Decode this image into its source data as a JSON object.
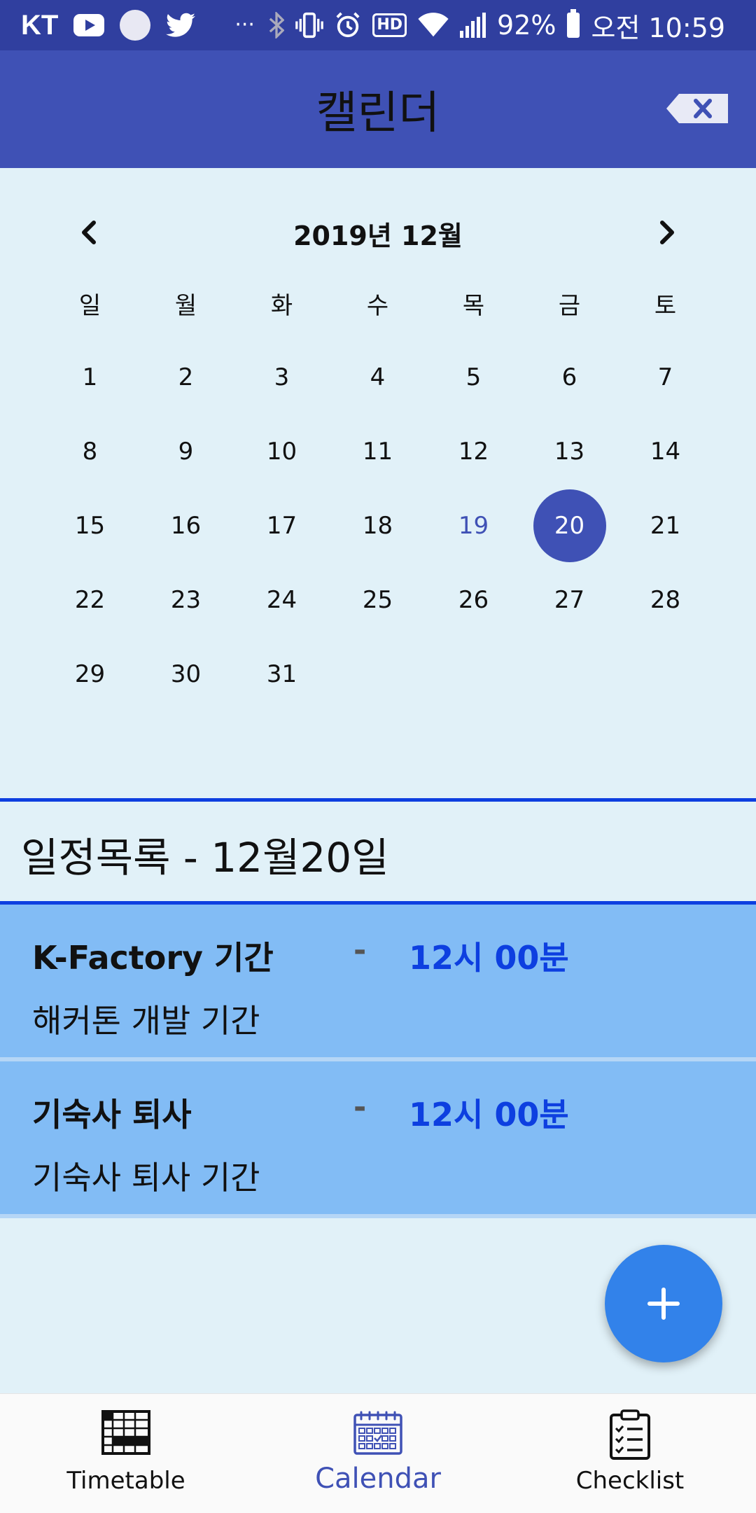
{
  "status_bar": {
    "carrier": "KT",
    "battery": "92%",
    "time": "오전 10:59",
    "more": "···"
  },
  "app_bar": {
    "title": "캘린더"
  },
  "calendar": {
    "month_label": "2019년 12월",
    "weekdays": [
      "일",
      "월",
      "화",
      "수",
      "목",
      "금",
      "토"
    ],
    "weeks": [
      [
        "1",
        "2",
        "3",
        "4",
        "5",
        "6",
        "7"
      ],
      [
        "8",
        "9",
        "10",
        "11",
        "12",
        "13",
        "14"
      ],
      [
        "15",
        "16",
        "17",
        "18",
        "19",
        "20",
        "21"
      ],
      [
        "22",
        "23",
        "24",
        "25",
        "26",
        "27",
        "28"
      ],
      [
        "29",
        "30",
        "31",
        "",
        "",
        "",
        ""
      ]
    ],
    "today": "19",
    "selected": "20"
  },
  "schedule": {
    "title": "일정목록 - 12월20일",
    "events": [
      {
        "name": "K-Factory 기간",
        "dash": "-",
        "time": "12시 00분",
        "desc": "해커톤 개발 기간"
      },
      {
        "name": "기숙사 퇴사",
        "dash": "-",
        "time": "12시 00분",
        "desc": "기숙사 퇴사 기간"
      }
    ]
  },
  "bottom_nav": {
    "items": [
      {
        "label": "Timetable",
        "icon": "timetable-icon"
      },
      {
        "label": "Calendar",
        "icon": "calendar-icon",
        "active": true
      },
      {
        "label": "Checklist",
        "icon": "checklist-icon"
      }
    ]
  },
  "colors": {
    "status_bar": "#303f9f",
    "app_bar": "#3f51b5",
    "background": "#e1f1f8",
    "event_bg": "#82bcf5",
    "accent_blue": "#0d3fe0",
    "fab": "#3282ea"
  }
}
